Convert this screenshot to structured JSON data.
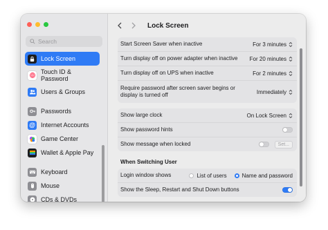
{
  "sidebar": {
    "search_placeholder": "Search",
    "items": [
      {
        "label": "Lock Screen",
        "icon": "lock-icon",
        "color": "#1c1c1e",
        "active": true
      },
      {
        "label": "Touch ID & Password",
        "icon": "fingerprint-icon",
        "color": "#ffffff"
      },
      {
        "label": "Users & Groups",
        "icon": "users-icon",
        "color": "#2f7bf5"
      },
      {
        "label": "Passwords",
        "icon": "key-icon",
        "color": "#8e8e93"
      },
      {
        "label": "Internet Accounts",
        "icon": "at-icon",
        "color": "#2f7bf5"
      },
      {
        "label": "Game Center",
        "icon": "game-center-icon",
        "color": "#ffffff"
      },
      {
        "label": "Wallet & Apple Pay",
        "icon": "wallet-icon",
        "color": "#1c1c1e"
      },
      {
        "label": "Keyboard",
        "icon": "keyboard-icon",
        "color": "#8e8e93"
      },
      {
        "label": "Mouse",
        "icon": "mouse-icon",
        "color": "#8e8e93"
      },
      {
        "label": "CDs & DVDs",
        "icon": "disc-icon",
        "color": "#8e8e93"
      }
    ]
  },
  "header": {
    "title": "Lock Screen"
  },
  "group1": [
    {
      "label": "Start Screen Saver when inactive",
      "value": "For 3 minutes"
    },
    {
      "label": "Turn display off on power adapter when inactive",
      "value": "For 20 minutes"
    },
    {
      "label": "Turn display off on UPS when inactive",
      "value": "For 2 minutes"
    },
    {
      "label": "Require password after screen saver begins or display is turned off",
      "value": "Immediately"
    }
  ],
  "group2": {
    "large_clock": {
      "label": "Show large clock",
      "value": "On Lock Screen"
    },
    "password_hints": {
      "label": "Show password hints",
      "on": false
    },
    "message": {
      "label": "Show message when locked",
      "on": false,
      "button": "Set..."
    }
  },
  "switching": {
    "title": "When Switching User",
    "login_window": {
      "label": "Login window shows",
      "option1": "List of users",
      "option2": "Name and password",
      "selected": "Name and password"
    },
    "sleep_buttons": {
      "label": "Show the Sleep, Restart and Shut Down buttons",
      "on": true
    }
  },
  "colors": {
    "accent": "#2f7bf5"
  }
}
